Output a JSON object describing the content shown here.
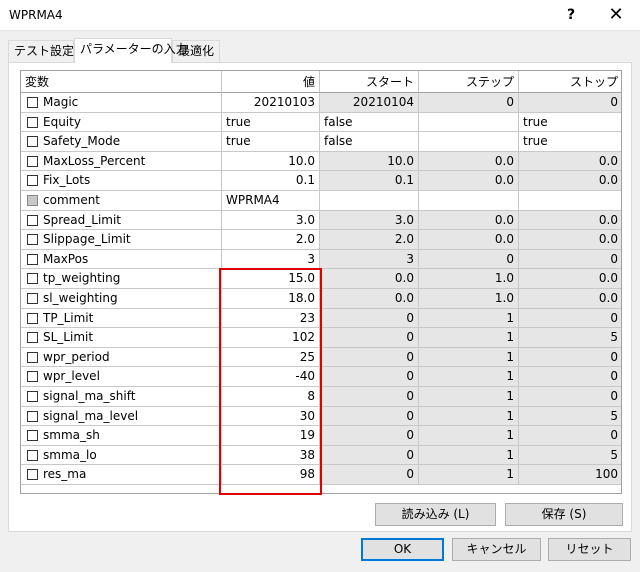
{
  "window": {
    "title": "WPRMA4",
    "help_glyph": "?",
    "close_glyph": "✕"
  },
  "tabs": [
    {
      "label": "テスト設定"
    },
    {
      "label": "パラメーターの入力"
    },
    {
      "label": "最適化"
    }
  ],
  "columns": [
    "変数",
    "値",
    "スタート",
    "ステップ",
    "ストップ"
  ],
  "rows": [
    {
      "name": "Magic",
      "value": "20210103",
      "start": "20210104",
      "step": "0",
      "stop": "0"
    },
    {
      "name": "Equity",
      "value": "true",
      "start": "false",
      "step": "",
      "stop": "true"
    },
    {
      "name": "Safety_Mode",
      "value": "true",
      "start": "false",
      "step": "",
      "stop": "true"
    },
    {
      "name": "MaxLoss_Percent",
      "value": "10.0",
      "start": "10.0",
      "step": "0.0",
      "stop": "0.0"
    },
    {
      "name": "Fix_Lots",
      "value": "0.1",
      "start": "0.1",
      "step": "0.0",
      "stop": "0.0"
    },
    {
      "name": "comment",
      "value": "WPRMA4",
      "start": "",
      "step": "",
      "stop": ""
    },
    {
      "name": "Spread_Limit",
      "value": "3.0",
      "start": "3.0",
      "step": "0.0",
      "stop": "0.0"
    },
    {
      "name": "Slippage_Limit",
      "value": "2.0",
      "start": "2.0",
      "step": "0.0",
      "stop": "0.0"
    },
    {
      "name": "MaxPos",
      "value": "3",
      "start": "3",
      "step": "0",
      "stop": "0"
    },
    {
      "name": "tp_weighting",
      "value": "15.0",
      "start": "0.0",
      "step": "1.0",
      "stop": "0.0"
    },
    {
      "name": "sl_weighting",
      "value": "18.0",
      "start": "0.0",
      "step": "1.0",
      "stop": "0.0"
    },
    {
      "name": "TP_Limit",
      "value": "23",
      "start": "0",
      "step": "1",
      "stop": "0"
    },
    {
      "name": "SL_Limit",
      "value": "102",
      "start": "0",
      "step": "1",
      "stop": "5"
    },
    {
      "name": "wpr_period",
      "value": "25",
      "start": "0",
      "step": "1",
      "stop": "0"
    },
    {
      "name": "wpr_level",
      "value": "-40",
      "start": "0",
      "step": "1",
      "stop": "0"
    },
    {
      "name": "signal_ma_shift",
      "value": "8",
      "start": "0",
      "step": "1",
      "stop": "0"
    },
    {
      "name": "signal_ma_level",
      "value": "30",
      "start": "0",
      "step": "1",
      "stop": "5"
    },
    {
      "name": "smma_sh",
      "value": "19",
      "start": "0",
      "step": "1",
      "stop": "0"
    },
    {
      "name": "smma_lo",
      "value": "38",
      "start": "0",
      "step": "1",
      "stop": "5"
    },
    {
      "name": "res_ma",
      "value": "98",
      "start": "0",
      "step": "1",
      "stop": "100"
    }
  ],
  "buttons": {
    "load": "読み込み (L)",
    "save": "保存 (S)",
    "ok": "OK",
    "cancel": "キャンセル",
    "reset": "リセット"
  }
}
